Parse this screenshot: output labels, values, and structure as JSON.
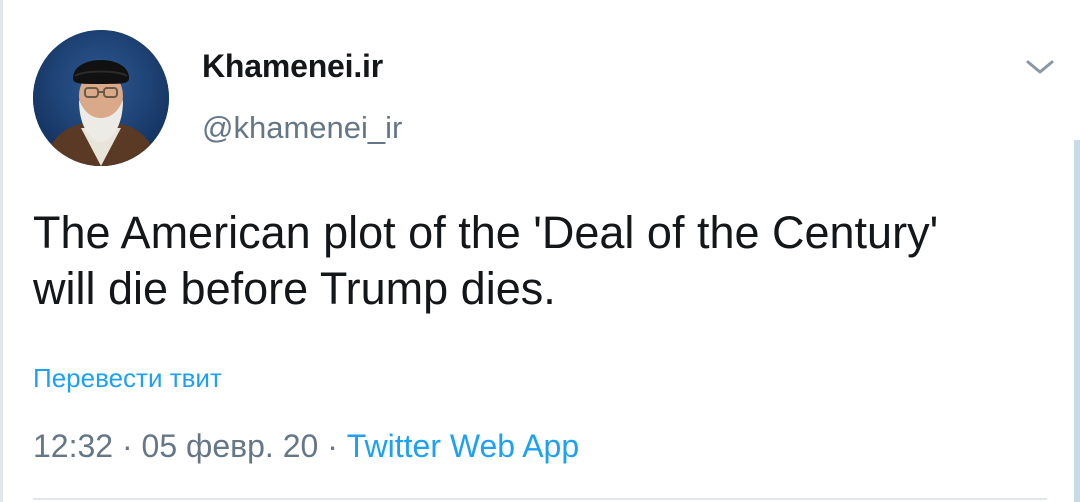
{
  "tweet": {
    "author": {
      "display_name": "Khamenei.ir",
      "handle": "@khamenei_ir",
      "avatar_icon": "profile-photo"
    },
    "text_lines": [
      "The American plot of the 'Deal of the Century'",
      "will die before Trump dies."
    ],
    "translate_label": "Перевести твит",
    "time": "12:32",
    "separator": " · ",
    "date": "05 февр. 20",
    "source": "Twitter Web App",
    "menu_icon": "chevron-down-icon"
  },
  "colors": {
    "text": "#14171a",
    "secondary": "#657786",
    "link": "#1da1f2",
    "divider": "#e1e8ed"
  }
}
